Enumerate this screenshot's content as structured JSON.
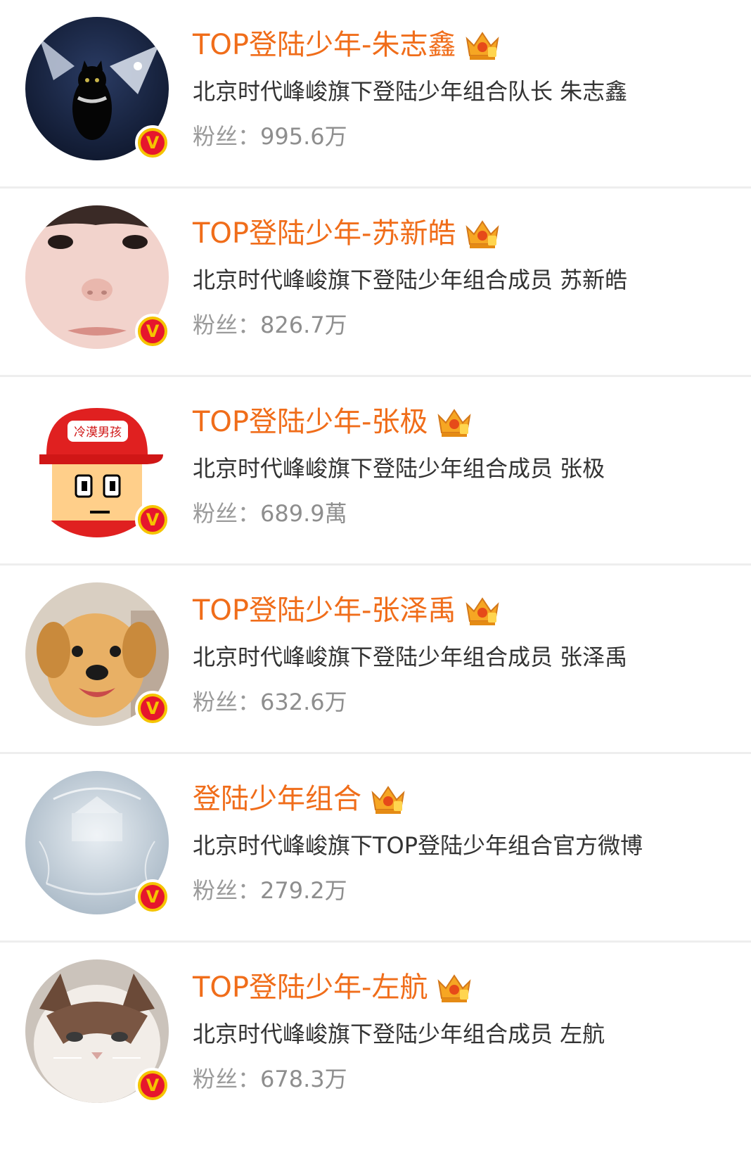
{
  "colors": {
    "name": "#f06d1a",
    "desc": "#333333",
    "fans": "#8e8e8e",
    "verified_badge": "#e6162d",
    "badge_ring": "#f5c400"
  },
  "icons": {
    "verified": "verified-v-icon",
    "member": "crown-icon"
  },
  "fans_label": "粉丝：",
  "verified_mark": "V",
  "accounts": [
    {
      "name": "TOP登陆少年-朱志鑫",
      "description": "北京时代峰峻旗下登陆少年组合队长 朱志鑫",
      "fans": "995.6万",
      "avatar": "black-cat-with-wings-avatar"
    },
    {
      "name": "TOP登陆少年-苏新皓",
      "description": "北京时代峰峻旗下登陆少年组合成员 苏新皓",
      "fans": "826.7万",
      "avatar": "face-closeup-avatar"
    },
    {
      "name": "TOP登陆少年-张极",
      "description": "北京时代峰峻旗下登陆少年组合成员 张极",
      "fans": "689.9萬",
      "avatar": "cartoon-boy-red-cap-avatar",
      "cap_text": "冷漠男孩"
    },
    {
      "name": "TOP登陆少年-张泽禹",
      "description": "北京时代峰峻旗下登陆少年组合成员 张泽禹",
      "fans": "632.6万",
      "avatar": "puppy-avatar"
    },
    {
      "name": "登陆少年组合",
      "description": "北京时代峰峻旗下TOP登陆少年组合官方微博",
      "fans": "279.2万",
      "avatar": "group-logo-avatar"
    },
    {
      "name": "TOP登陆少年-左航",
      "description": "北京时代峰峻旗下登陆少年组合成员 左航",
      "fans": "678.3万",
      "avatar": "ragdoll-cat-avatar"
    }
  ]
}
